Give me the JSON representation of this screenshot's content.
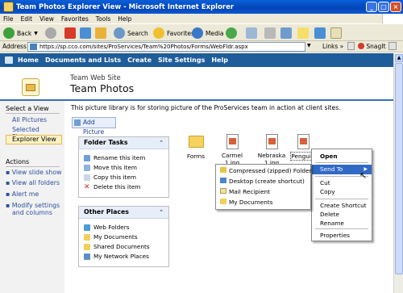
{
  "window": {
    "title": "Team Photos Explorer View - Microsoft Internet Explorer"
  },
  "menu": [
    "File",
    "Edit",
    "View",
    "Favorites",
    "Tools",
    "Help"
  ],
  "toolbar": {
    "back": "Back",
    "search": "Search",
    "favorites": "Favorites",
    "media": "Media",
    "snagit": "SnagIt"
  },
  "address": {
    "label": "Address",
    "url": "https://sp.cco.com/sites/ProServices/Team%20Photos/Forms/WebFldr.aspx",
    "links": "Links"
  },
  "site_nav": [
    "Home",
    "Documents and Lists",
    "Create",
    "Site Settings",
    "Help"
  ],
  "header": {
    "site_name": "Team Web Site",
    "page_title": "Team Photos"
  },
  "left_nav": {
    "select_view": "Select a View",
    "views": [
      "All Pictures",
      "Selected Pictures",
      "Explorer View"
    ],
    "actions_title": "Actions",
    "actions": [
      "View slide show",
      "View all folders",
      "Alert me",
      "Modify settings",
      "and columns"
    ]
  },
  "description": "This picture library is for storing picture of the ProServices team in action at client sites.",
  "add_picture": "Add Picture",
  "folder_tasks": {
    "title": "Folder Tasks",
    "items": [
      "Rename this item",
      "Move this item",
      "Copy this item",
      "Delete this item"
    ]
  },
  "other_places": {
    "title": "Other Places",
    "items": [
      "Web Folders",
      "My Documents",
      "Shared Documents",
      "My Network Places"
    ]
  },
  "files": [
    "Forms",
    "Carmel 1.jpg",
    "Nebraska",
    "1.jpg",
    "Penguin"
  ],
  "context_menu": [
    "Open",
    "Send To",
    "Cut",
    "Copy",
    "Create Shortcut",
    "Delete",
    "Rename",
    "Properties"
  ],
  "send_to_menu": [
    "Compressed (zipped) Folder",
    "Desktop (create shortcut)",
    "Mail Recipient",
    "My Documents"
  ]
}
